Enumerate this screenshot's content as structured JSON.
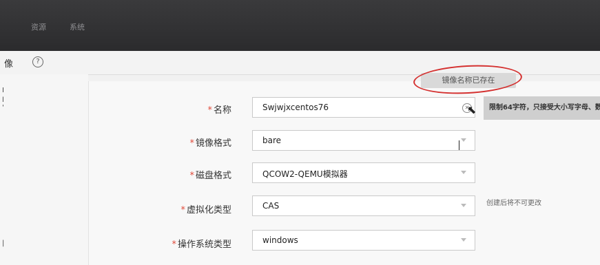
{
  "topbar": {
    "nav": [
      "资源",
      "系统"
    ]
  },
  "subbar": {
    "title": "像",
    "help": "?"
  },
  "left_marks": [
    "I",
    "l",
    "'",
    "|"
  ],
  "tooltip": "镜像名称已存在",
  "hint": "限制64字符，只接受大小写字母、数",
  "form": {
    "rows": [
      {
        "label": "名称",
        "value": "Swjwjxcentos76",
        "type": "text"
      },
      {
        "label": "镜像格式",
        "value": "bare",
        "type": "select"
      },
      {
        "label": "磁盘格式",
        "value": "QCOW2-QEMU模拟器",
        "type": "select"
      },
      {
        "label": "虚拟化类型",
        "value": "CAS",
        "type": "select"
      },
      {
        "label": "操作系统类型",
        "value": "windows",
        "type": "select"
      }
    ],
    "virt_note": "创建后将不可更改"
  },
  "icons": {
    "clear": "clear-circle-icon",
    "cursor": "mouse-cursor-icon"
  }
}
